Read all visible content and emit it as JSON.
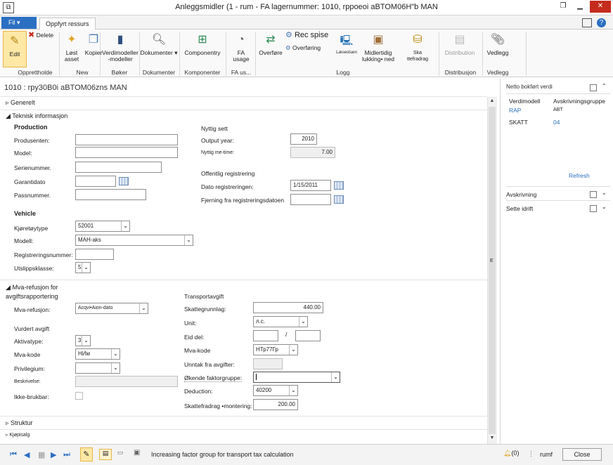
{
  "window": {
    "title": "Anleggsmidler (1 - rum - FA lagernummer: 1010, rppoeoi aBTOM06H\"b MAN",
    "app_icon": "ax-app-icon"
  },
  "ribbon": {
    "file_tab": "Fil",
    "active_tab": "Oppfyrt ressurs",
    "buttons": {
      "edit": "Edit",
      "delete": "Delete",
      "new_asset": "Løst asset",
      "copy": "Kopier",
      "value_models": "Verdimodeller -modeller",
      "documents": "Dokumenter",
      "components": "Componentry",
      "fa_usage": "FA usage",
      "transfer": "Overføre",
      "rec_spise": "Rec spise",
      "overforing": "Overføring",
      "laesestuen": "Læsestuen",
      "temp_closing": "Midlertidig lukking• ned",
      "tax_deduct": "Ska ttefradrag",
      "distribution": "Distribution",
      "attachment": "Vedlegg"
    },
    "groups": {
      "maintain": "Opprettholde",
      "new": "New",
      "books": "Bøker",
      "documents": "Dokumenter",
      "components": "Komponenter",
      "fa_usage": "FA us...",
      "log": "Logg",
      "distribution": "Distribusjon",
      "attachments": "Vedlegg"
    }
  },
  "record": {
    "title": "1010 : rpy30B0i aBTOM06zns MAN"
  },
  "sections": {
    "general": "Generelt",
    "technical": "Teknisk informasjon",
    "vat_refund": "Mva-refusjon for avgiftsrapportering",
    "structure": "Struktur",
    "purchase": "Kjøpisalg"
  },
  "technical": {
    "production_hdr": "Production",
    "producer_label": "Produsenten:",
    "model_label": "Model:",
    "serial_label": "Serienummer.",
    "warranty_label": "Garantidato",
    "passport_label": "Passnummer.",
    "useful_life_hdr": "Nyttig sett",
    "output_year_label": "Output year:",
    "output_year_value": "2010",
    "useful_time_label": "Nyttig me-time:",
    "useful_time_value": "7.00",
    "public_reg_hdr": "Offentlig registrering",
    "reg_date_label": "Dato registreringen:",
    "reg_date_value": "1/15/2011",
    "dereg_date_label": "Fjerning fra registreringsdatoen",
    "vehicle_hdr": "Vehicle",
    "vehicle_type_label": "Kjøretøytype",
    "vehicle_type_value": "52001",
    "model2_label": "Modell:",
    "model2_value": "MAH-aks",
    "reg_number_label": "Registreringsnummer:",
    "emission_label": "Utslippsklasse:",
    "emission_value": "5"
  },
  "vat": {
    "vat_refund_label": "Mva-refusjon:",
    "vat_refund_value": "Acqvi•Aion-dato",
    "assessed_hdr": "Vurdert avgift",
    "activity_label": "Aktivatype:",
    "activity_value": "3",
    "vat_code_label": "Mva-kode",
    "vat_code_value": "НИм",
    "privilege_label": "Privilegium:",
    "description_label": "Beskrivelse:",
    "unusable_label": "Ikke-brukbar:",
    "transport_hdr": "Transportavgift",
    "tax_base_label": "Skattegrunnlag:",
    "tax_base_value": "440.00",
    "unit_label": "Unit:",
    "unit_value": "л.с.",
    "share_label": "Eid del:",
    "share_sep": "/",
    "vat_code2_label": "Mva-kode",
    "vat_code2_value": "НТр77Гр",
    "exempt_label": "Unntak fra avgifter:",
    "factor_label": "Økende faktorgruppe:",
    "deduction_label": "Deduction:",
    "deduction_value": "40200",
    "tax_deduct_label": "Skattefradrag •montering:",
    "tax_deduct_value": "200.00"
  },
  "rightpane": {
    "net_book_hdr": "Netto bokført verdi",
    "col_model": "Verdimodell",
    "col_group": "Avskrivningsgruppe",
    "rows": [
      {
        "model": "RAP",
        "group": "ABT"
      },
      {
        "model": "SKATT",
        "group": "04"
      }
    ],
    "refresh": "Refresh",
    "depreciation": "Avskrivning",
    "put_in_service": "Sette idrift"
  },
  "statusbar": {
    "text": "Increasing factor group for transport tax calculation",
    "notifications": "(0)",
    "company": "rumf",
    "close": "Close"
  },
  "colors": {
    "accent": "#2b6fc2",
    "edit_highlight": "#ffe8a6",
    "close_red": "#c42b1c"
  }
}
